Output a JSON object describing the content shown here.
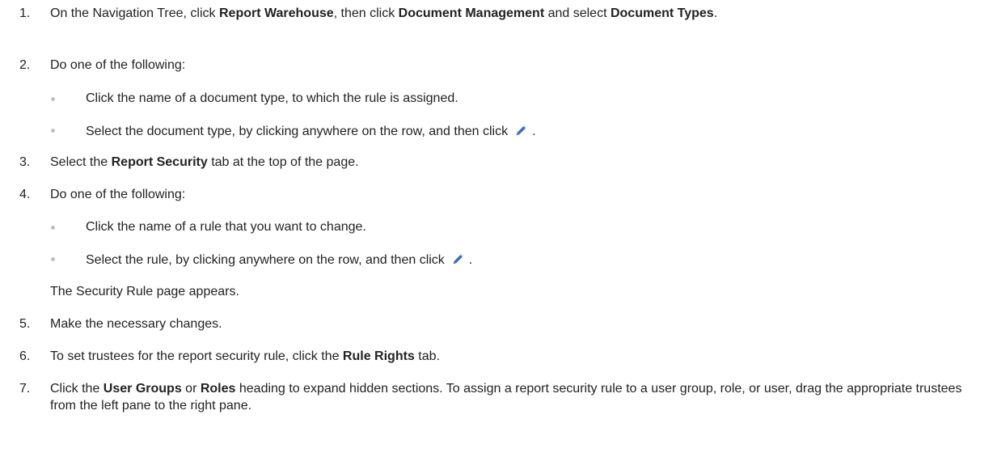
{
  "steps": [
    {
      "number": "1.",
      "parts": [
        "On the Navigation Tree, click ",
        "Report Warehouse",
        ", then click ",
        "Document Management",
        " and select ",
        "Document Types",
        "."
      ]
    },
    {
      "number": "2.",
      "text": "Do one of the following:",
      "bullets": [
        "Click the name of a document type, to which the rule is assigned.",
        "Select the document type, by clicking anywhere on the row, and then click"
      ]
    },
    {
      "number": "3.",
      "parts": [
        "Select the ",
        "Report Security",
        " tab at the top of the page."
      ]
    },
    {
      "number": "4.",
      "text": "Do one of the following:",
      "bullets": [
        "Click the name of a rule that you want to change.",
        "Select the rule, by clicking anywhere on the row, and then click"
      ],
      "note": "The Security Rule page appears."
    },
    {
      "number": "5.",
      "text": "Make the necessary changes."
    },
    {
      "number": "6.",
      "parts": [
        "To set trustees for the report security rule, click the ",
        "Rule Rights",
        " tab."
      ]
    },
    {
      "number": "7.",
      "parts": [
        "Click the ",
        "User Groups",
        " or ",
        "Roles",
        " heading to expand hidden sections. To assign a report security rule to a user group, role, or user, drag the appropriate trustees from the left pane to the right pane."
      ]
    }
  ],
  "punctuation": {
    "period": "."
  },
  "icons": {
    "edit": "pencil-edit-icon"
  },
  "colors": {
    "text": "#222222",
    "bullet": "#b9c3bd",
    "pencil_body": "#3c6fb4",
    "pencil_tip": "#d9e6f5"
  }
}
